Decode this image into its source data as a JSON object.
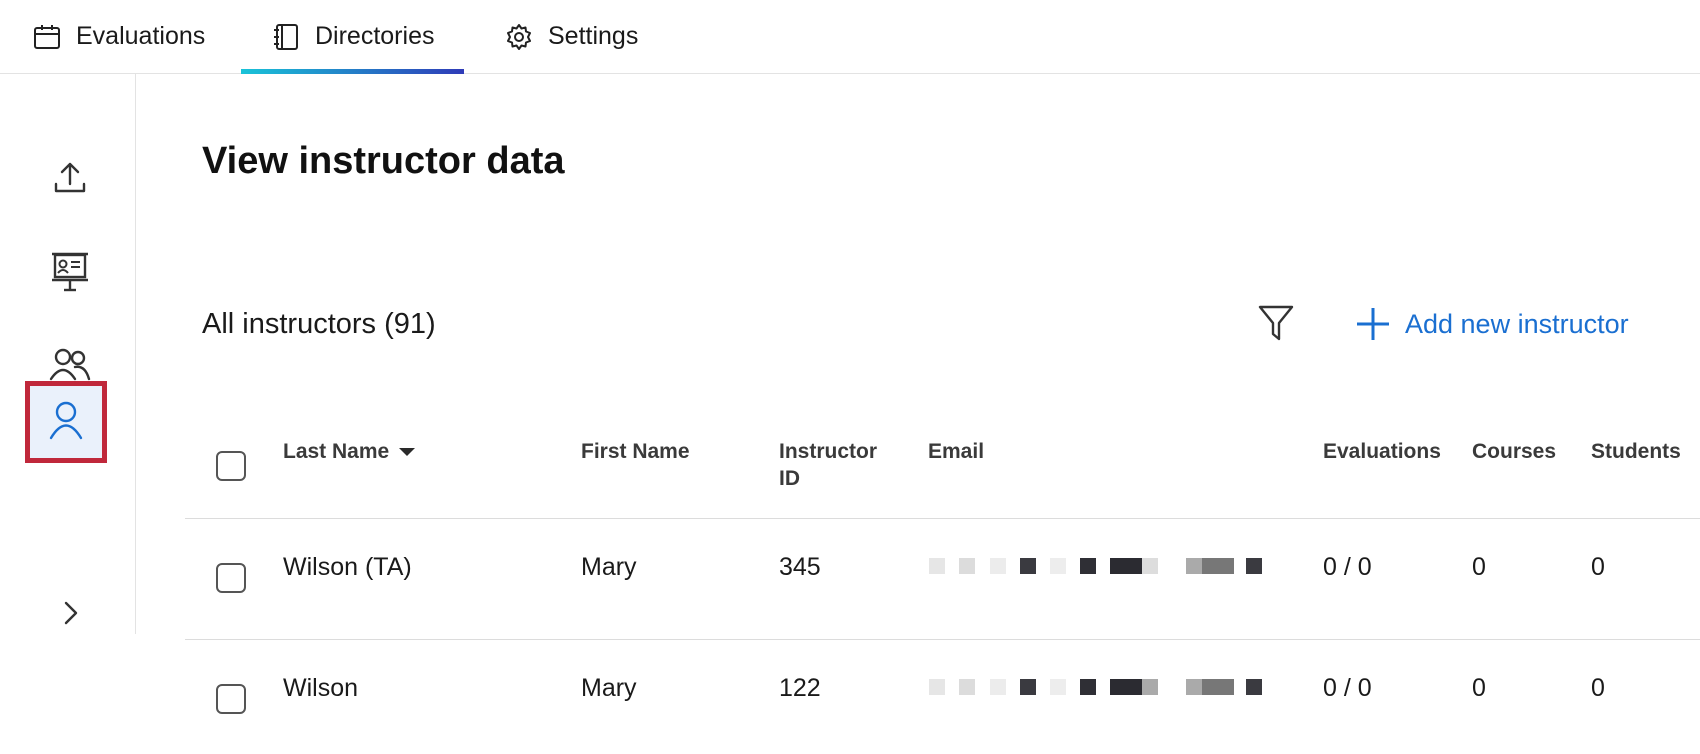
{
  "tabs": [
    {
      "label": "Evaluations",
      "icon": "calendar-icon",
      "active": false
    },
    {
      "label": "Directories",
      "icon": "directory-book-icon",
      "active": true
    },
    {
      "label": "Settings",
      "icon": "gear-icon",
      "active": false
    }
  ],
  "sidebar": {
    "items": [
      {
        "name": "upload",
        "icon": "upload-icon"
      },
      {
        "name": "courses",
        "icon": "presentation-board-icon"
      },
      {
        "name": "students",
        "icon": "people-icon"
      },
      {
        "name": "instructors",
        "icon": "person-icon",
        "active": true
      },
      {
        "name": "expand",
        "icon": "chevron-right-icon"
      }
    ]
  },
  "main": {
    "title": "View instructor data",
    "list_title": "All instructors (91)",
    "add_label": "Add new instructor"
  },
  "table": {
    "columns": [
      "Last Name",
      "First Name",
      "Instructor ID",
      "Email",
      "Evaluations",
      "Courses",
      "Students"
    ],
    "rows": [
      {
        "last_name": "Wilson (TA)",
        "first_name": "Mary",
        "instructor_id": "345",
        "evaluations": "0 / 0",
        "courses": "0",
        "students": "0"
      },
      {
        "last_name": "Wilson",
        "first_name": "Mary",
        "instructor_id": "122",
        "evaluations": "0 / 0",
        "courses": "0",
        "students": "0"
      }
    ]
  },
  "colors": {
    "accent_blue": "#1a6fd1",
    "highlight_red": "#c0283b",
    "tab_gradient_start": "#19c3d8",
    "tab_gradient_end": "#2f3bb8"
  }
}
